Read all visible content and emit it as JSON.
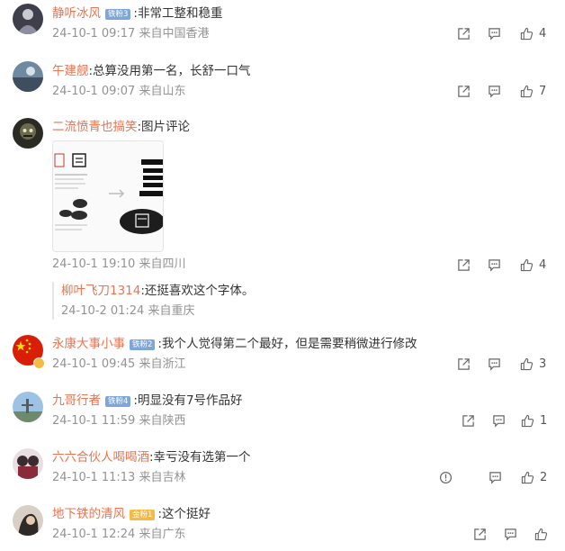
{
  "comments": [
    {
      "username": "静听冰风",
      "badge": "铁粉3",
      "text": ":非常工整和稳重",
      "time": "24-10-1 09:17",
      "location": "来自中国香港",
      "likes": "4"
    },
    {
      "username": "午建舰",
      "text": ":总算没用第一名，长舒一口气",
      "time": "24-10-1 09:07",
      "location": "来自山东",
      "likes": "7"
    },
    {
      "username": "二流愤青也搞笑",
      "text": ":图片评论",
      "time": "24-10-1 19:10",
      "location": "来自四川",
      "likes": "4",
      "reply": {
        "username": "柳叶飞刀1314",
        "text": ":还挺喜欢这个字体。",
        "time": "24-10-2 01:24",
        "location": "来自重庆"
      }
    },
    {
      "username": "永康大事小事",
      "badge": "铁粉2",
      "text": ":我个人觉得第二个最好，但是需要稍微进行修改",
      "time": "24-10-1 09:45",
      "location": "来自浙江",
      "likes": "3"
    },
    {
      "username": "九哥行者",
      "badge": "铁粉4",
      "text": ":明显没有7号作品好",
      "time": "24-10-1 11:59",
      "location": "来自陕西",
      "likes": "1"
    },
    {
      "username": "六六合伙人喝喝酒",
      "text": ":幸亏没有选第一个",
      "time": "24-10-1 11:13",
      "location": "来自吉林",
      "likes": "2"
    },
    {
      "username": "地下铁的清风",
      "badge": "金粉1",
      "text": ":这个挺好",
      "time": "24-10-1 12:24",
      "location": "来自广东",
      "likes": ""
    }
  ],
  "icons": {
    "share": "share-icon",
    "comment": "comment-icon",
    "like": "like-icon",
    "report": "report-icon"
  },
  "colors": {
    "username": "#eb7350",
    "meta": "#939393",
    "badge_iron": "#7ea6d9",
    "badge_gold": "#f5b945"
  }
}
